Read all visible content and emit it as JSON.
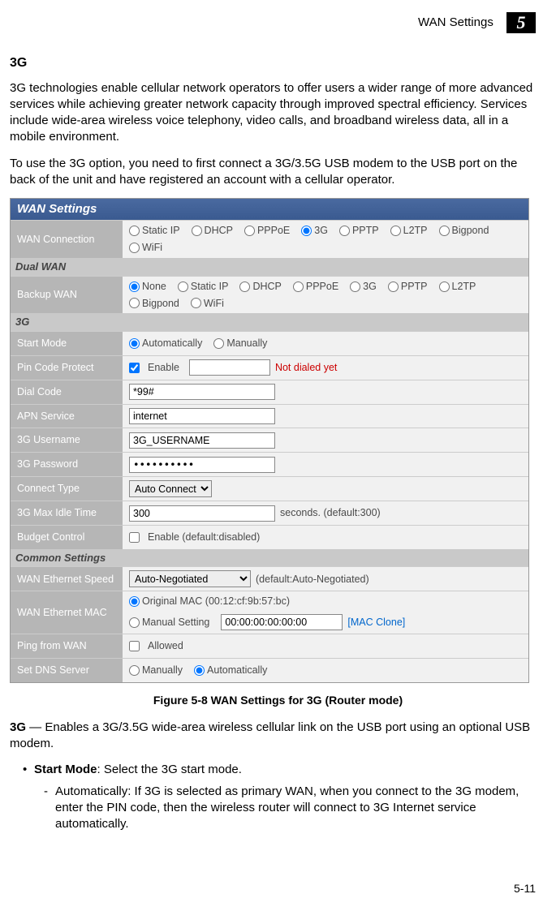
{
  "header": {
    "section": "WAN Settings",
    "chapter": "5"
  },
  "section_heading": "3G",
  "intro_p1": "3G technologies enable cellular network operators to offer users a wider range of more advanced services while achieving greater network capacity through improved spectral efficiency. Services include wide-area wireless voice telephony, video calls, and broadband wireless data, all in a mobile environment.",
  "intro_p2": "To use the 3G option, you need to first connect a 3G/3.5G USB modem to the USB port on the back of the unit and have registered an account with a cellular operator.",
  "ui": {
    "title": "WAN Settings",
    "wan_conn_label": "WAN Connection",
    "wan_conn_opts": [
      "Static IP",
      "DHCP",
      "PPPoE",
      "3G",
      "PPTP",
      "L2TP",
      "Bigpond",
      "WiFi"
    ],
    "section_dualwan": "Dual WAN",
    "backup_label": "Backup WAN",
    "backup_opts": [
      "None",
      "Static IP",
      "DHCP",
      "PPPoE",
      "3G",
      "PPTP",
      "L2TP",
      "Bigpond",
      "WiFi"
    ],
    "section_3g": "3G",
    "start_mode_label": "Start Mode",
    "start_mode_opts": [
      "Automatically",
      "Manually"
    ],
    "pin_label": "Pin Code Protect",
    "pin_enable": "Enable",
    "pin_status": "Not dialed yet",
    "dial_label": "Dial Code",
    "dial_value": "*99#",
    "apn_label": "APN Service",
    "apn_value": "internet",
    "user_label": "3G Username",
    "user_value": "3G_USERNAME",
    "pass_label": "3G Password",
    "pass_value": "••••••••••",
    "connect_label": "Connect Type",
    "connect_value": "Auto Connect",
    "idle_label": "3G Max Idle Time",
    "idle_value": "300",
    "idle_suffix": "seconds. (default:300)",
    "budget_label": "Budget Control",
    "budget_text": "Enable (default:disabled)",
    "section_common": "Common Settings",
    "speed_label": "WAN Ethernet Speed",
    "speed_value": "Auto-Negotiated",
    "speed_suffix": "(default:Auto-Negotiated)",
    "mac_label": "WAN Ethernet MAC",
    "mac_orig": "Original MAC (00:12:cf:9b:57:bc)",
    "mac_manual": "Manual Setting",
    "mac_value": "00:00:00:00:00:00",
    "mac_clone": "[MAC Clone]",
    "ping_label": "Ping from WAN",
    "ping_text": "Allowed",
    "dns_label": "Set DNS Server",
    "dns_opts": [
      "Manually",
      "Automatically"
    ]
  },
  "figure_caption": "Figure 5-8  WAN Settings for 3G (Router mode)",
  "desc_3g_label": "3G",
  "desc_3g_text": " — Enables a 3G/3.5G wide-area wireless cellular link on the USB port using an optional USB modem.",
  "bullet_start_label": "Start Mode",
  "bullet_start_text": ": Select the 3G start mode.",
  "sub_auto": "Automatically: If 3G is selected as primary WAN, when you connect to the 3G modem, enter the PIN code, then the wireless router will connect to 3G Internet service automatically.",
  "page_number": "5-11"
}
